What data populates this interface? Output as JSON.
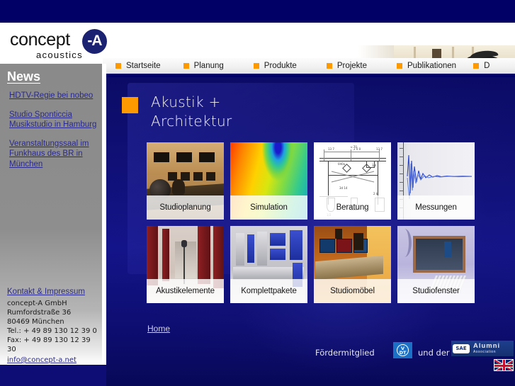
{
  "brand": {
    "logo_text": "concept",
    "logo_mark": "-A",
    "logo_sub": "acoustics"
  },
  "nav": {
    "items": [
      {
        "label": "Startseite"
      },
      {
        "label": "Planung"
      },
      {
        "label": "Produkte"
      },
      {
        "label": "Projekte"
      },
      {
        "label": "Publikationen"
      },
      {
        "label": "D"
      }
    ],
    "bullet_color": "#ff9900"
  },
  "sidebar": {
    "title": "News",
    "news": [
      {
        "label": "HDTV-Regie bei nobeo"
      },
      {
        "label": "Studio Sponticcia Musikstudio in Hamburg"
      },
      {
        "label": "Veranstaltungssaal im Funkhaus des BR in München"
      }
    ],
    "contact": {
      "link_label": "Kontakt & Impressum",
      "company": "concept-A GmbH",
      "street": "Rumfordstraße 36",
      "city": "80469 München",
      "tel": "Tel.: + 49 89 130 12 39 0",
      "fax": "Fax: + 49 89 130 12 39 30",
      "email": "info@concept-a.net"
    }
  },
  "main": {
    "title": "Akustik +\nArchitektur",
    "bullet_color": "#ff9900",
    "tiles": [
      {
        "caption": "Studioplanung"
      },
      {
        "caption": "Simulation"
      },
      {
        "caption": "Beratung"
      },
      {
        "caption": "Messungen"
      },
      {
        "caption": "Akustikelemente"
      },
      {
        "caption": "Komplettpakete"
      },
      {
        "caption": "Studiomöbel"
      },
      {
        "caption": "Studiofenster"
      }
    ],
    "home_label": "Home"
  },
  "footer": {
    "foerder_label": "Fördermitglied",
    "und_der_label": "und der",
    "vdt": {
      "line1": "V",
      "line2": "DT"
    },
    "sae": {
      "mark": "SAE",
      "title": "Alumni",
      "subtitle": "Association"
    },
    "flag": "uk-flag"
  },
  "colors": {
    "navy_dark": "#000066",
    "navy_main": "#14148a",
    "accent_orange": "#ff9900",
    "link_blue": "#2a2a8c"
  }
}
